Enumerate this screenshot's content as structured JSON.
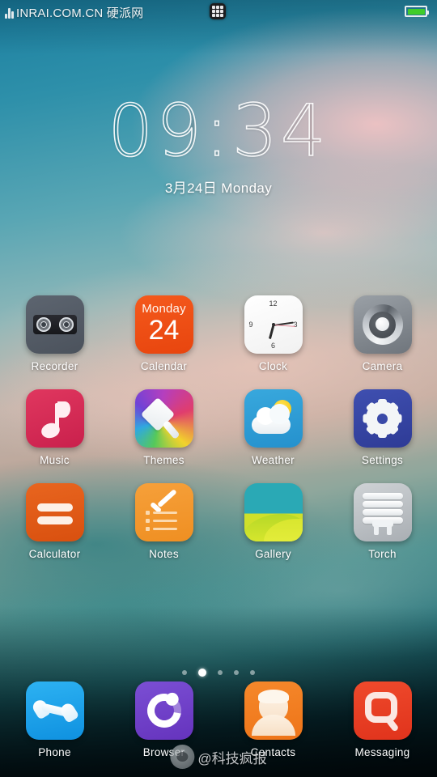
{
  "status_bar": {
    "watermark_left": "INRAI.COM.CN 硬派网",
    "grid_icon_name": "blackberry-grid-icon",
    "battery_icon_name": "battery-icon",
    "battery_color": "#3fcc2a"
  },
  "clock_widget": {
    "time": "09:34",
    "date": "3月24日 Monday"
  },
  "grid": {
    "rows": [
      [
        {
          "label": "Recorder",
          "icon": "recorder-icon",
          "color": "#545b66"
        },
        {
          "label": "Calendar",
          "icon": "calendar-icon",
          "color": "#ef4e12",
          "day": "Monday",
          "date_number": "24"
        },
        {
          "label": "Clock",
          "icon": "clock-icon",
          "color": "#ffffff",
          "numerals": [
            "12",
            "3",
            "6",
            "9"
          ]
        },
        {
          "label": "Camera",
          "icon": "camera-icon",
          "color": "#7e848b"
        }
      ],
      [
        {
          "label": "Music",
          "icon": "music-note-icon",
          "color": "#d42a52"
        },
        {
          "label": "Themes",
          "icon": "paintbrush-icon",
          "color": "#56c95a"
        },
        {
          "label": "Weather",
          "icon": "sun-cloud-icon",
          "color": "#2e9dd4"
        },
        {
          "label": "Settings",
          "icon": "gear-icon",
          "color": "#3a49a8"
        }
      ],
      [
        {
          "label": "Calculator",
          "icon": "equals-icon",
          "color": "#e05a15"
        },
        {
          "label": "Notes",
          "icon": "checklist-icon",
          "color": "#f2972e"
        },
        {
          "label": "Gallery",
          "icon": "landscape-icon",
          "color": "#2aa9b5"
        },
        {
          "label": "Torch",
          "icon": "lightbulb-icon",
          "color": "#bcc1c5"
        }
      ]
    ],
    "dock": [
      {
        "label": "Phone",
        "icon": "phone-handset-icon",
        "color": "#19a2e8"
      },
      {
        "label": "Browser",
        "icon": "browser-swirl-icon",
        "color": "#6f3fc9"
      },
      {
        "label": "Contacts",
        "icon": "person-icon",
        "color": "#f27e20"
      },
      {
        "label": "Messaging",
        "icon": "speech-bubble-icon",
        "color": "#e83f22"
      }
    ]
  },
  "page_indicator": {
    "count": 5,
    "active_index": 1
  },
  "bottom_watermark": {
    "logo": "weibo-logo",
    "text": "@科技疯报"
  }
}
